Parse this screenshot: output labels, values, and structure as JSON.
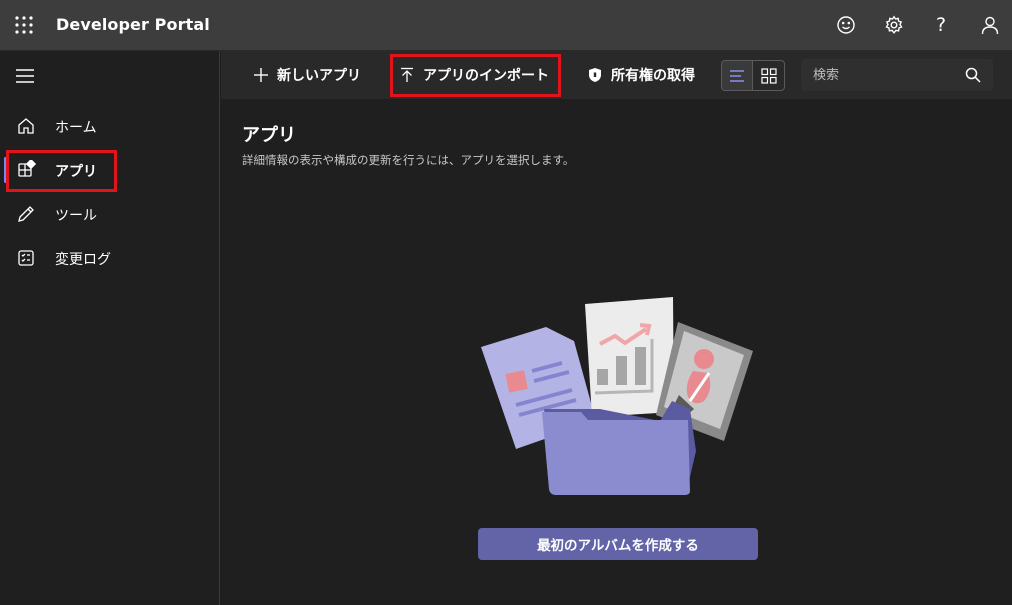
{
  "header": {
    "app_title": "Developer Portal",
    "icons": [
      "waffle-icon",
      "smiley-icon",
      "gear-icon",
      "help-icon",
      "person-icon"
    ],
    "help_glyph": "?"
  },
  "sidebar": {
    "items": [
      {
        "label": "ホーム",
        "icon": "home-icon"
      },
      {
        "label": "アプリ",
        "icon": "apps-icon",
        "active": true
      },
      {
        "label": "ツール",
        "icon": "pencil-icon"
      },
      {
        "label": "変更ログ",
        "icon": "changelog-icon"
      }
    ]
  },
  "toolbar": {
    "new_app_label": "新しいアプリ",
    "import_app_label": "アプリのインポート",
    "take_ownership_label": "所有権の取得",
    "search_placeholder": "検索"
  },
  "main": {
    "title": "アプリ",
    "subtitle": "詳細情報の表示や構成の更新を行うには、アプリを選択します。",
    "cta_label": "最初のアルバムを作成する"
  },
  "colors": {
    "accent": "#6264a7",
    "highlight": "#e3131b",
    "active_bar": "#7f85f5",
    "topbar": "#3d3d3d",
    "toolbar": "#292929",
    "background": "#1f1f1f"
  }
}
